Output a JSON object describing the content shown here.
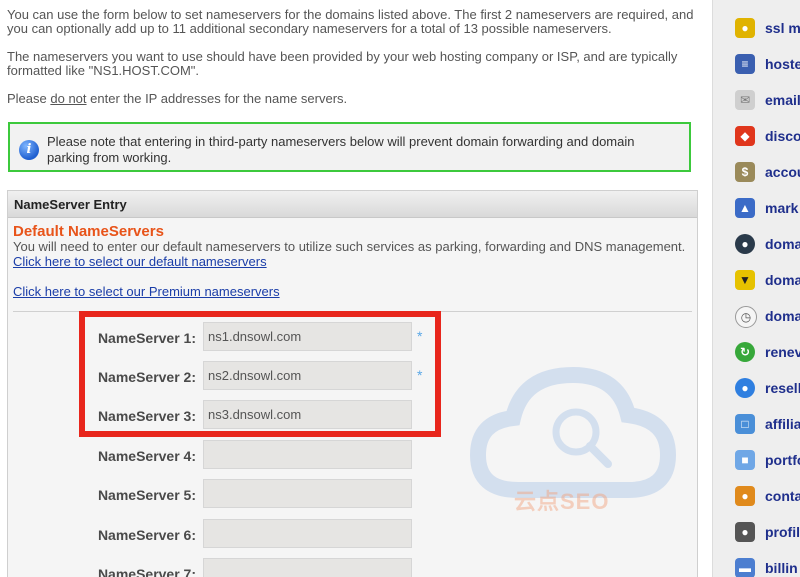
{
  "intro": {
    "p1": "You can use the form below to set nameservers for the domains listed above. The first 2 nameservers are required, and you can optionally add up to 11 additional secondary nameservers for a total of 13 possible nameservers.",
    "p2": "The nameservers you want to use should have been provided by your web hosting company or ISP, and are typically formatted like \"NS1.HOST.COM\".",
    "p3_before": "Please ",
    "p3_underlined": "do not",
    "p3_after": " enter the IP addresses for the name servers."
  },
  "notice": {
    "icon": "info-icon",
    "text": "Please note that entering in third-party nameservers below will prevent domain forwarding and domain parking from working."
  },
  "panel": {
    "header": "NameServer Entry",
    "section_title": "Default NameServers",
    "section_desc": "You will need to enter our default nameservers to utilize such services as parking, forwarding and DNS management.",
    "link_default": "Click here to select our default nameservers",
    "link_premium": "Click here to select our Premium nameservers"
  },
  "nameservers": [
    {
      "label": "NameServer 1:",
      "value": "ns1.dnsowl.com",
      "required": "*"
    },
    {
      "label": "NameServer 2:",
      "value": "ns2.dnsowl.com",
      "required": "*"
    },
    {
      "label": "NameServer 3:",
      "value": "ns3.dnsowl.com",
      "required": ""
    },
    {
      "label": "NameServer 4:",
      "value": "",
      "required": ""
    },
    {
      "label": "NameServer 5:",
      "value": "",
      "required": ""
    },
    {
      "label": "NameServer 6:",
      "value": "",
      "required": ""
    },
    {
      "label": "NameServer 7:",
      "value": "",
      "required": ""
    }
  ],
  "watermark_text": "云点SEO",
  "sidebar": [
    {
      "label": "ssl m",
      "icon": "lock-icon"
    },
    {
      "label": "hoste",
      "icon": "server-icon"
    },
    {
      "label": "email",
      "icon": "envelope-icon"
    },
    {
      "label": "disco",
      "icon": "tag-icon"
    },
    {
      "label": "accou",
      "icon": "money-bag-icon"
    },
    {
      "label": "mark",
      "icon": "market-icon"
    },
    {
      "label": "doma",
      "icon": "globe-icon"
    },
    {
      "label": "doma",
      "icon": "shield-icon"
    },
    {
      "label": "doma",
      "icon": "clock-icon"
    },
    {
      "label": "renev",
      "icon": "renew-icon"
    },
    {
      "label": "resell",
      "icon": "reseller-globe-icon"
    },
    {
      "label": "affilia",
      "icon": "monitor-icon"
    },
    {
      "label": "portfo",
      "icon": "folder-icon"
    },
    {
      "label": "conta",
      "icon": "contacts-icon"
    },
    {
      "label": "profil",
      "icon": "profile-icon"
    },
    {
      "label": "billin",
      "icon": "credit-card-icon"
    }
  ]
}
